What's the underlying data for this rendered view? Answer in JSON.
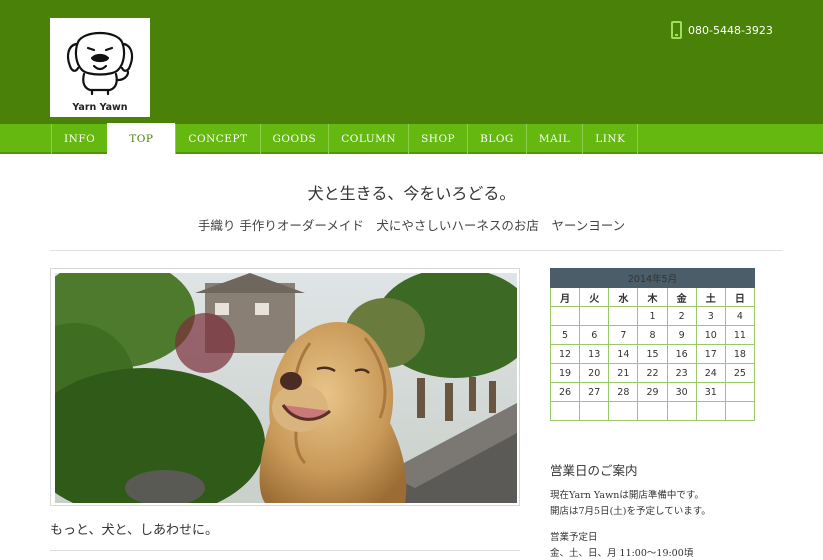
{
  "brand": {
    "logo_text": "Yarn Yawn",
    "phone": "080-5448-3923",
    "colors": {
      "header": "#4a8209",
      "nav": "#64b80f",
      "calendar_header": "#4a5d68"
    }
  },
  "nav": {
    "items": [
      {
        "label": "INFO"
      },
      {
        "label": "TOP",
        "active": true
      },
      {
        "label": "CONCEPT"
      },
      {
        "label": "GOODS"
      },
      {
        "label": "COLUMN"
      },
      {
        "label": "SHOP"
      },
      {
        "label": "BLOG"
      },
      {
        "label": "MAIL"
      },
      {
        "label": "LINK"
      }
    ]
  },
  "hero": {
    "tagline": "犬と生きる、今をいろどる。",
    "subtitle": "手織り 手作りオーダーメイド　犬にやさしいハーネスのお店　ヤーンヨーン"
  },
  "main": {
    "caption": "もっと、犬と、しあわせに。"
  },
  "calendar": {
    "title": "2014年5月",
    "weekdays": [
      "月",
      "火",
      "水",
      "木",
      "金",
      "土",
      "日"
    ],
    "weeks": [
      [
        "",
        "",
        "",
        "1",
        "2",
        "3",
        "4"
      ],
      [
        "5",
        "6",
        "7",
        "8",
        "9",
        "10",
        "11"
      ],
      [
        "12",
        "13",
        "14",
        "15",
        "16",
        "17",
        "18"
      ],
      [
        "19",
        "20",
        "21",
        "22",
        "23",
        "24",
        "25"
      ],
      [
        "26",
        "27",
        "28",
        "29",
        "30",
        "31",
        ""
      ]
    ]
  },
  "sidebar": {
    "heading": "営業日のご案内",
    "line1": "現在Yarn Yawnは開店準備中です。",
    "line2": "開店は7月5日(土)を予定しています。",
    "line3": "営業予定日",
    "line4": "金、土、日、月  11:00～19:00頃"
  }
}
